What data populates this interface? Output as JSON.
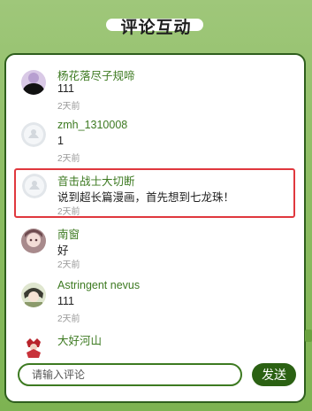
{
  "header": {
    "title": "评论互动"
  },
  "comments": [
    {
      "name": "杨花落尽子规啼",
      "text": "111",
      "time": "2天前",
      "avatar": "photo-avatar-dark"
    },
    {
      "name": "zmh_1310008",
      "text": "1",
      "time": "2天前",
      "avatar": "default-avatar"
    },
    {
      "name": "音击战士大切断",
      "text": "说到超长篇漫画，首先想到七龙珠！",
      "time": "2天前",
      "avatar": "default-avatar"
    },
    {
      "name": "南窗",
      "text": "好",
      "time": "2天前",
      "avatar": "anime-avatar"
    },
    {
      "name": "Astringent nevus",
      "text": "111",
      "time": "2天前",
      "avatar": "anime-avatar-2"
    },
    {
      "name": "大好河山",
      "text": "",
      "time": "",
      "avatar": "character-avatar"
    }
  ],
  "composer": {
    "placeholder": "请输入评论",
    "send_label": "发送"
  },
  "colors": {
    "accent": "#3d7a21",
    "button": "#2b6113",
    "highlight": "#e0383e",
    "background": "#8dbd63"
  }
}
